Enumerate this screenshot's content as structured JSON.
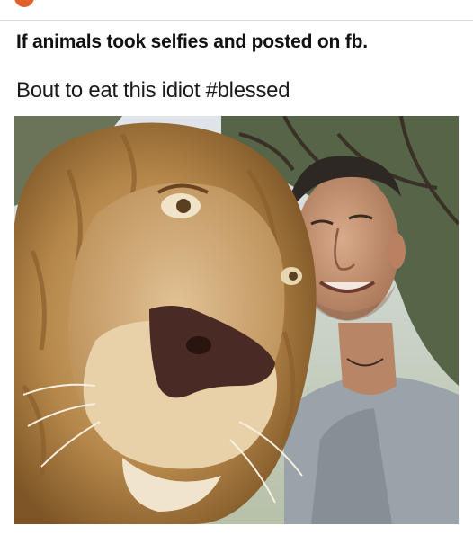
{
  "meme": {
    "caption": "If animals took selfies and posted on fb.",
    "post_text": "Bout to eat this idiot #blessed"
  },
  "photo": {
    "subject": "lion selfie with man",
    "colors": {
      "sky": "#c9d2dc",
      "trees": "#4a5a3a",
      "mane": "#b5874a",
      "mane_dark": "#8a5f2c",
      "face": "#cfa774",
      "nose": "#4a2a24",
      "skin": "#c79a7a",
      "hair": "#2e2824",
      "shirt": "#9aa2aa"
    }
  },
  "accent": "#e0622a"
}
